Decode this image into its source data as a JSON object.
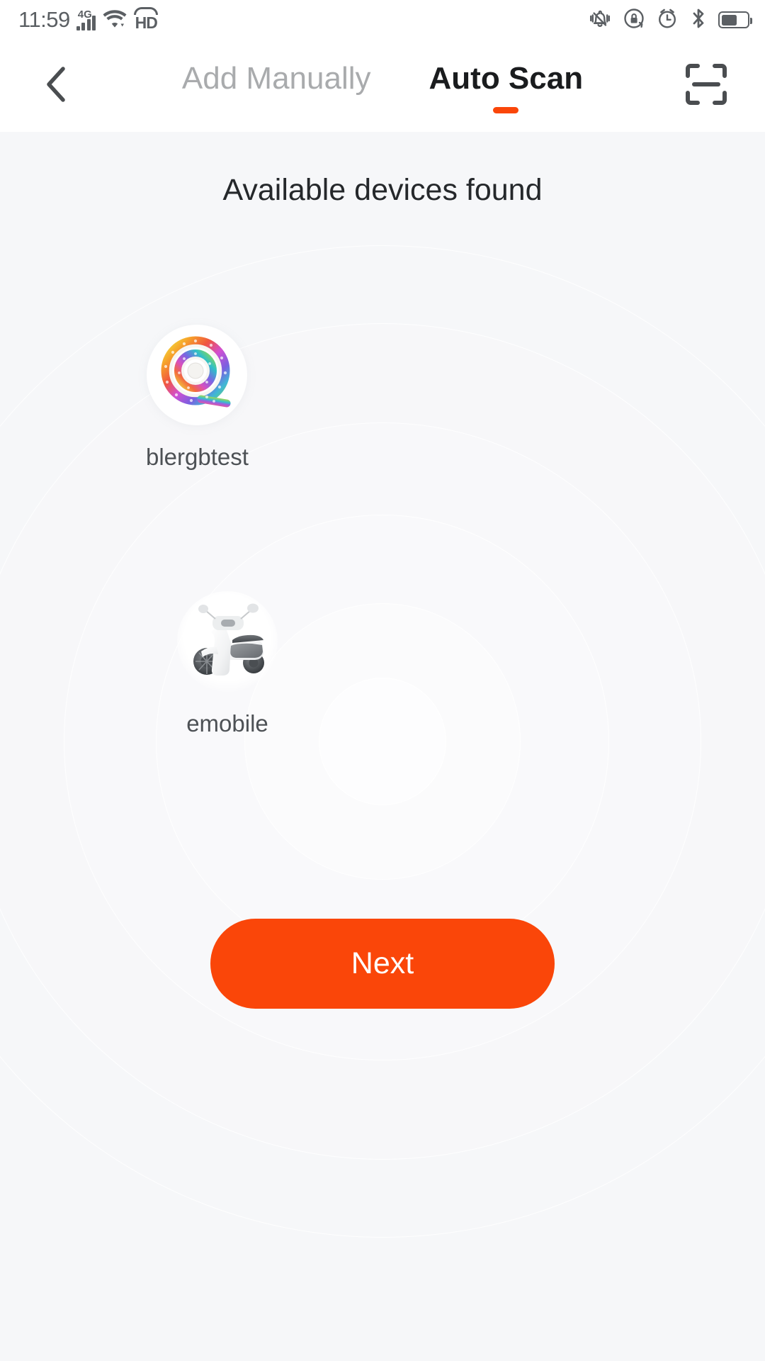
{
  "status_bar": {
    "time": "11:59",
    "network_type": "4G",
    "signal_icon": "signal-bars-icon",
    "wifi_icon": "wifi-icon",
    "volte_label": "HD",
    "icons_right": [
      "vibrate-bell-icon",
      "rotation-lock-icon",
      "alarm-clock-icon",
      "bluetooth-icon",
      "battery-icon"
    ],
    "battery_percent": 62
  },
  "navbar": {
    "back_icon": "back-chevron-icon",
    "scan_icon": "qr-scan-icon",
    "tabs": [
      {
        "label": "Add Manually",
        "active": false,
        "name": "tab-add-manually"
      },
      {
        "label": "Auto Scan",
        "active": true,
        "name": "tab-auto-scan"
      }
    ],
    "active_indicator_color": "#FA4609"
  },
  "main": {
    "heading": "Available devices found",
    "devices": [
      {
        "name": "blergbtest",
        "icon": "rgb-light-strip-icon"
      },
      {
        "name": "emobile",
        "icon": "electric-scooter-icon"
      }
    ]
  },
  "footer": {
    "next_label": "Next",
    "next_color": "#FA4609"
  },
  "theme": {
    "background": "#F6F7F9",
    "bar_background": "#FFFFFF",
    "accent": "#FA4609",
    "text_primary": "#25282B",
    "text_muted": "#A9ABAD",
    "status_icon": "#5B5F63"
  }
}
